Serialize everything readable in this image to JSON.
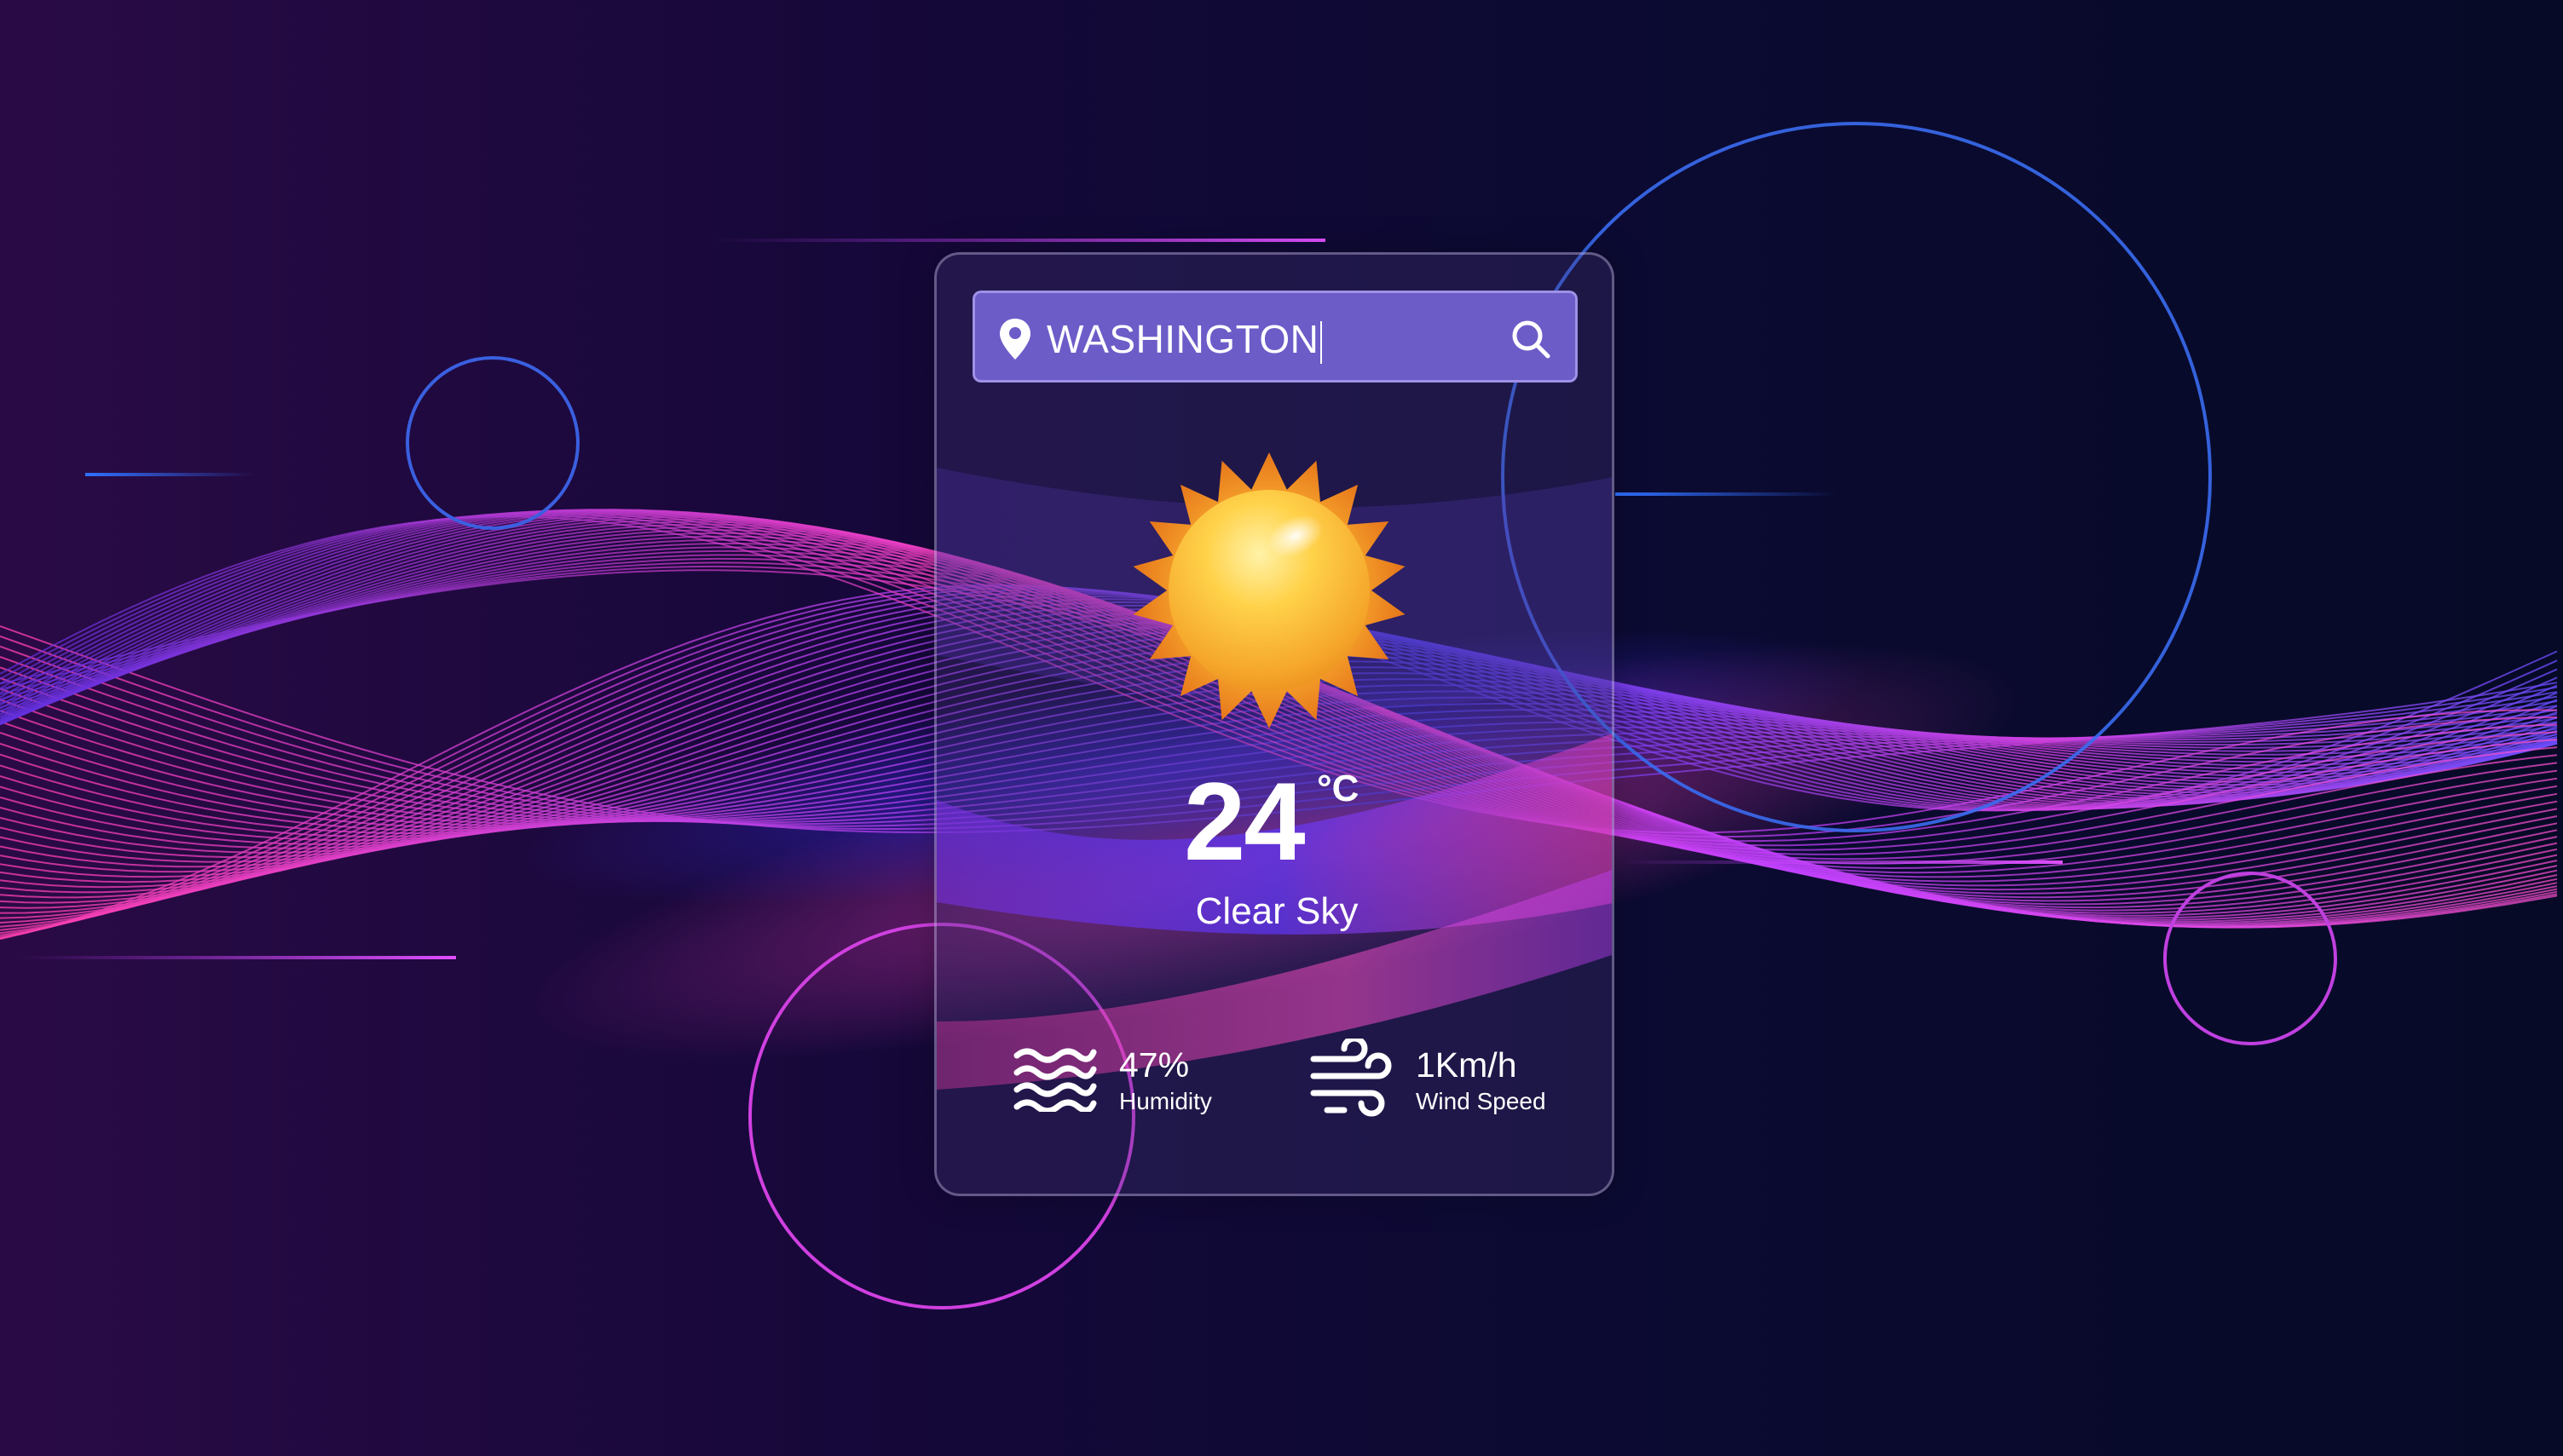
{
  "search": {
    "value": "WASHINGTON"
  },
  "weather": {
    "temperature": "24",
    "unit": "°C",
    "condition": "Clear Sky"
  },
  "stats": {
    "humidity": {
      "value": "47%",
      "label": "Humidity"
    },
    "wind": {
      "value": "1Km/h",
      "label": "Wind Speed"
    }
  },
  "icons": {
    "location": "map-pin-icon",
    "search": "search-icon",
    "weather": "sun-icon",
    "humidity": "waves-icon",
    "wind": "wind-icon"
  },
  "colors": {
    "search_bar": "#6c5cc8",
    "sun": "#f7b733",
    "wave_pink": "#e040c8",
    "wave_blue": "#4a3cf0"
  }
}
